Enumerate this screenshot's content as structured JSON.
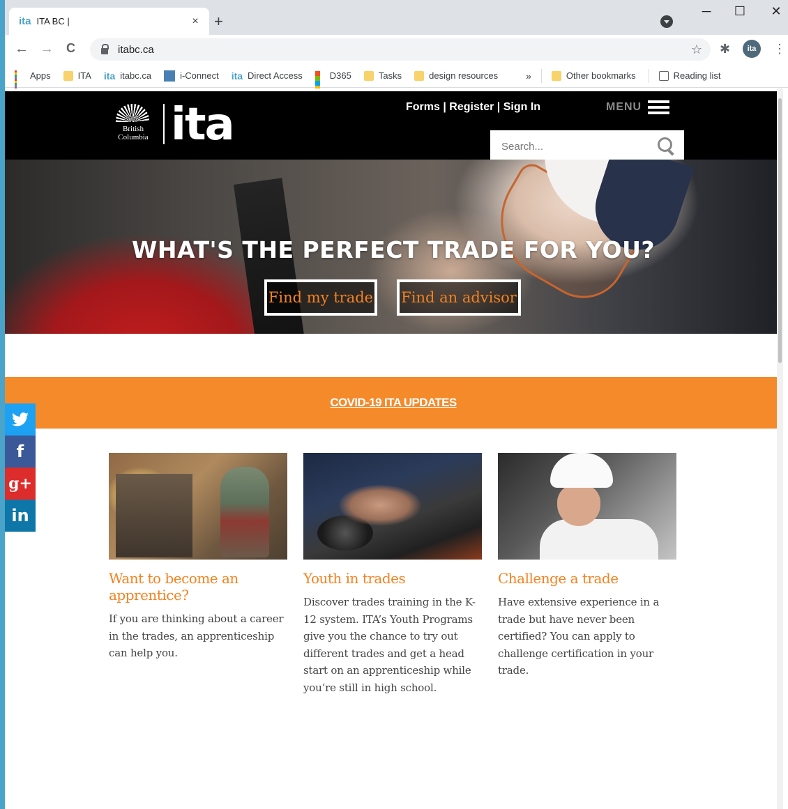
{
  "browser": {
    "tab_favicon": "ita",
    "tab_title": "ITA BC |",
    "tab_close": "×",
    "new_tab": "+",
    "window_controls": {
      "minimize": "─",
      "maximize": "☐",
      "close": "✕"
    },
    "nav": {
      "back": "←",
      "forward": "→",
      "reload": "C"
    },
    "url": "itabc.ca",
    "star": "☆",
    "avatar_text": "ita",
    "bookmarks": [
      {
        "label": "Apps",
        "icon": "apps-grid-icon"
      },
      {
        "label": "ITA",
        "icon": "folder-icon"
      },
      {
        "label": "itabc.ca",
        "icon": "ita-favicon"
      },
      {
        "label": "i-Connect",
        "icon": "iconnect-favicon"
      },
      {
        "label": "Direct Access",
        "icon": "ita-favicon"
      },
      {
        "label": "D365",
        "icon": "microsoft-icon"
      },
      {
        "label": "Tasks",
        "icon": "folder-icon"
      },
      {
        "label": "design resources",
        "icon": "folder-icon"
      }
    ],
    "bookmarks_more": "»",
    "other_bookmarks": "Other bookmarks",
    "reading_list": "Reading list"
  },
  "site": {
    "logo_bc_line1": "British",
    "logo_bc_line2": "Columbia",
    "logo_ita": "ita",
    "top_links": {
      "forms": "Forms",
      "register": "Register",
      "sign_in": "Sign In",
      "sep": "|"
    },
    "menu_label": "MENU",
    "search_placeholder": "Search..."
  },
  "hero": {
    "title": "WHAT'S THE PERFECT TRADE FOR YOU?",
    "btn_find_trade": "Find my trade",
    "btn_find_advisor": "Find an advisor"
  },
  "covid": {
    "link": "COVID-19 ITA UPDATES"
  },
  "social": [
    {
      "name": "twitter",
      "glyph": "t",
      "color": "#1da1f2"
    },
    {
      "name": "facebook",
      "glyph": "f",
      "color": "#3b5998"
    },
    {
      "name": "google-plus",
      "glyph": "g+",
      "color": "#dd2c2c"
    },
    {
      "name": "linkedin",
      "glyph": "in",
      "color": "#0e76a8"
    }
  ],
  "cards": [
    {
      "title": "Want to become an apprentice?",
      "text": "If you are thinking about a career in the trades, an apprenticeship can help you."
    },
    {
      "title": "Youth in trades",
      "text": "Discover trades training in the K-12 system. ITA’s Youth Programs give you the chance to try out different trades and get a head start on an apprenticeship while you’re still in high school."
    },
    {
      "title": "Challenge a trade",
      "text": "Have extensive experience in a trade but have never been certified? You can apply to challenge certification in your trade."
    }
  ],
  "colors": {
    "accent_orange": "#f58220",
    "covid_bar": "#f58a2b",
    "header_black": "#000000"
  }
}
